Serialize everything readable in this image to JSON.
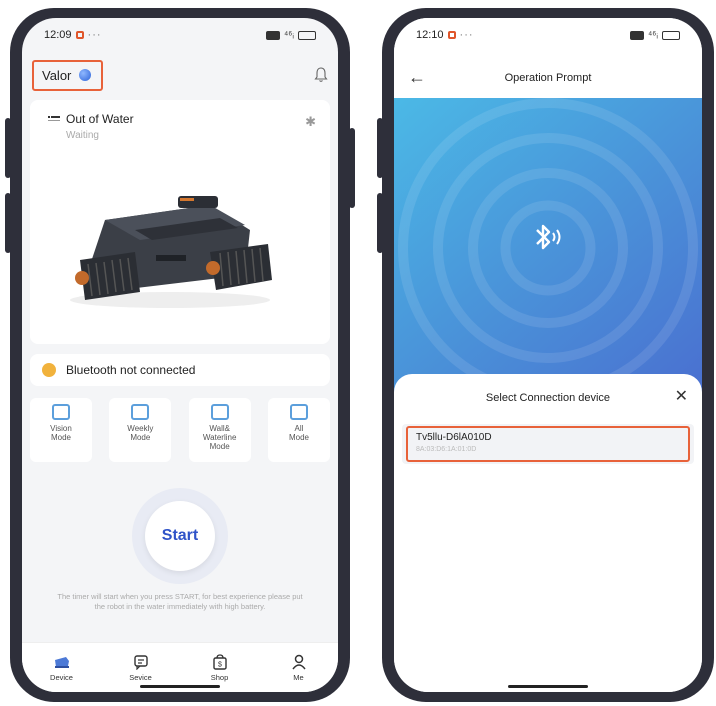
{
  "left_phone": {
    "status": {
      "time": "12:09",
      "more": "···",
      "signal": "⁴⁶ᵢ",
      "battery": ""
    },
    "header": {
      "brand": "Valor"
    },
    "device": {
      "status_title": "Out of Water",
      "status_sub": "Waiting"
    },
    "bluetooth_status": "Bluetooth not connected",
    "modes": [
      {
        "label": "Vision\nMode"
      },
      {
        "label": "Weekly\nMode"
      },
      {
        "label": "Wall&\nWaterline\nMode"
      },
      {
        "label": "All\nMode"
      }
    ],
    "start_label": "Start",
    "hint": "The timer will start when you press START, for best experience please put the robot in the water immediately with high battery.",
    "tabs": [
      {
        "label": "Device",
        "icon": "robot-icon"
      },
      {
        "label": "Sevice",
        "icon": "service-icon"
      },
      {
        "label": "Shop",
        "icon": "shop-icon"
      },
      {
        "label": "Me",
        "icon": "person-icon"
      }
    ]
  },
  "right_phone": {
    "status": {
      "time": "12:10",
      "more": "···",
      "signal": "⁴⁶ᵢ"
    },
    "header": {
      "title": "Operation Prompt"
    },
    "sheet": {
      "title": "Select Connection device",
      "devices": [
        {
          "name": "Tv5llu-D6lA010D",
          "mac": "8A:03:D6:1A:01:0D"
        }
      ]
    }
  },
  "colors": {
    "accent_orange": "#e8623a",
    "bluetooth_warning": "#f1b23c",
    "start_blue": "#2f53c8",
    "gradient_start": "#4bb9e6",
    "gradient_end": "#4a6fd0"
  }
}
